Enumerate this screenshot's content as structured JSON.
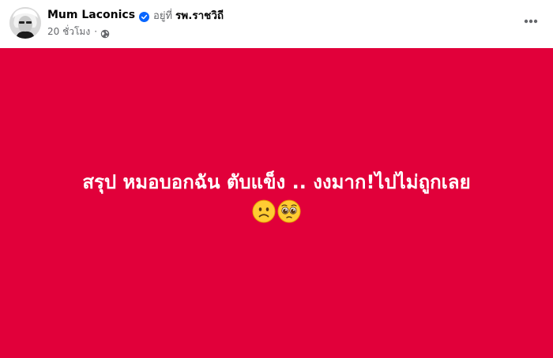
{
  "post": {
    "author": "Mum Laconics",
    "verified_icon": "verified-badge-icon",
    "at_label": "อยู่ที่",
    "location": "รพ.ราชวิถี",
    "time": "20 ชั่วโมง",
    "separator": "·",
    "privacy_icon": "globe-icon",
    "more_icon": "more-options-icon",
    "text": "สรุป หมอบอกฉัน ตับแข็ง .. งงมาก!ไปไม่ถูกเลย",
    "emojis": [
      "slightly-frowning-face-emoji",
      "pleading-face-emoji"
    ],
    "background_color": "#e1003a",
    "text_color": "#ffffff"
  }
}
